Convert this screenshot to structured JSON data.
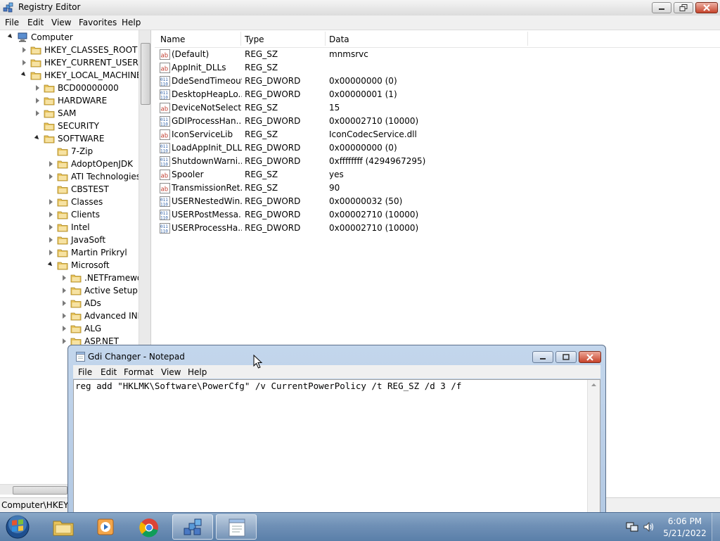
{
  "regedit": {
    "title": "Registry Editor",
    "menu": [
      "File",
      "Edit",
      "View",
      "Favorites",
      "Help"
    ],
    "tree": [
      {
        "label": "Computer",
        "level": 0,
        "state": "expanded",
        "icon": "computer-icon"
      },
      {
        "label": "HKEY_CLASSES_ROOT",
        "level": 1,
        "state": "collapsed"
      },
      {
        "label": "HKEY_CURRENT_USER",
        "level": 1,
        "state": "collapsed"
      },
      {
        "label": "HKEY_LOCAL_MACHINE",
        "level": 1,
        "state": "expanded"
      },
      {
        "label": "BCD00000000",
        "level": 2,
        "state": "collapsed"
      },
      {
        "label": "HARDWARE",
        "level": 2,
        "state": "collapsed"
      },
      {
        "label": "SAM",
        "level": 2,
        "state": "collapsed"
      },
      {
        "label": "SECURITY",
        "level": 2,
        "state": "none"
      },
      {
        "label": "SOFTWARE",
        "level": 2,
        "state": "expanded"
      },
      {
        "label": "7-Zip",
        "level": 3,
        "state": "none"
      },
      {
        "label": "AdoptOpenJDK",
        "level": 3,
        "state": "collapsed"
      },
      {
        "label": "ATI Technologies",
        "level": 3,
        "state": "collapsed"
      },
      {
        "label": "CBSTEST",
        "level": 3,
        "state": "none"
      },
      {
        "label": "Classes",
        "level": 3,
        "state": "collapsed"
      },
      {
        "label": "Clients",
        "level": 3,
        "state": "collapsed"
      },
      {
        "label": "Intel",
        "level": 3,
        "state": "collapsed"
      },
      {
        "label": "JavaSoft",
        "level": 3,
        "state": "collapsed"
      },
      {
        "label": "Martin Prikryl",
        "level": 3,
        "state": "collapsed"
      },
      {
        "label": "Microsoft",
        "level": 3,
        "state": "expanded"
      },
      {
        "label": ".NETFramewo",
        "level": 4,
        "state": "collapsed"
      },
      {
        "label": "Active Setup",
        "level": 4,
        "state": "collapsed"
      },
      {
        "label": "ADs",
        "level": 4,
        "state": "collapsed"
      },
      {
        "label": "Advanced INF",
        "level": 4,
        "state": "collapsed"
      },
      {
        "label": "ALG",
        "level": 4,
        "state": "collapsed"
      },
      {
        "label": "ASP.NET",
        "level": 4,
        "state": "collapsed"
      }
    ],
    "columns": {
      "name": "Name",
      "type": "Type",
      "data": "Data"
    },
    "values": [
      {
        "name": "(Default)",
        "type": "REG_SZ",
        "data": "mnmsrvc",
        "icon": "string-value-icon"
      },
      {
        "name": "AppInit_DLLs",
        "type": "REG_SZ",
        "data": "",
        "icon": "string-value-icon"
      },
      {
        "name": "DdeSendTimeout",
        "type": "REG_DWORD",
        "data": "0x00000000 (0)",
        "icon": "binary-value-icon"
      },
      {
        "name": "DesktopHeapLo...",
        "type": "REG_DWORD",
        "data": "0x00000001 (1)",
        "icon": "binary-value-icon"
      },
      {
        "name": "DeviceNotSelect...",
        "type": "REG_SZ",
        "data": "15",
        "icon": "string-value-icon"
      },
      {
        "name": "GDIProcessHan...",
        "type": "REG_DWORD",
        "data": "0x00002710 (10000)",
        "icon": "binary-value-icon"
      },
      {
        "name": "IconServiceLib",
        "type": "REG_SZ",
        "data": "IconCodecService.dll",
        "icon": "string-value-icon"
      },
      {
        "name": "LoadAppInit_DLLs",
        "type": "REG_DWORD",
        "data": "0x00000000 (0)",
        "icon": "binary-value-icon"
      },
      {
        "name": "ShutdownWarni...",
        "type": "REG_DWORD",
        "data": "0xffffffff (4294967295)",
        "icon": "binary-value-icon"
      },
      {
        "name": "Spooler",
        "type": "REG_SZ",
        "data": "yes",
        "icon": "string-value-icon"
      },
      {
        "name": "TransmissionRet...",
        "type": "REG_SZ",
        "data": "90",
        "icon": "string-value-icon"
      },
      {
        "name": "USERNestedWin...",
        "type": "REG_DWORD",
        "data": "0x00000032 (50)",
        "icon": "binary-value-icon"
      },
      {
        "name": "USERPostMessa...",
        "type": "REG_DWORD",
        "data": "0x00002710 (10000)",
        "icon": "binary-value-icon"
      },
      {
        "name": "USERProcessHa...",
        "type": "REG_DWORD",
        "data": "0x00002710 (10000)",
        "icon": "binary-value-icon"
      }
    ],
    "status": "Computer\\HKEY_"
  },
  "notepad": {
    "title": "Gdi Changer - Notepad",
    "menu": [
      "File",
      "Edit",
      "Format",
      "View",
      "Help"
    ],
    "content": "reg add \"HKLMK\\Software\\PowerCfg\" /v CurrentPowerPolicy /t REG_SZ /d 3 /f"
  },
  "taskbar": {
    "buttons": [
      {
        "name": "explorer-task-button",
        "icon": "folder-icon",
        "active": false
      },
      {
        "name": "media-player-task-button",
        "icon": "media-player-icon",
        "active": false
      },
      {
        "name": "chrome-task-button",
        "icon": "chrome-icon",
        "active": false
      },
      {
        "name": "regedit-task-button",
        "icon": "registry-icon",
        "active": true
      },
      {
        "name": "notepad-task-button",
        "icon": "notepad-icon",
        "active": true
      }
    ],
    "time": "6:06 PM",
    "date": "5/21/2022"
  },
  "colors": {
    "taskbar": "#6f90b6",
    "folder": "#e8c35a",
    "string_icon": "#c0392b",
    "binary_icon": "#2c5fa8"
  }
}
